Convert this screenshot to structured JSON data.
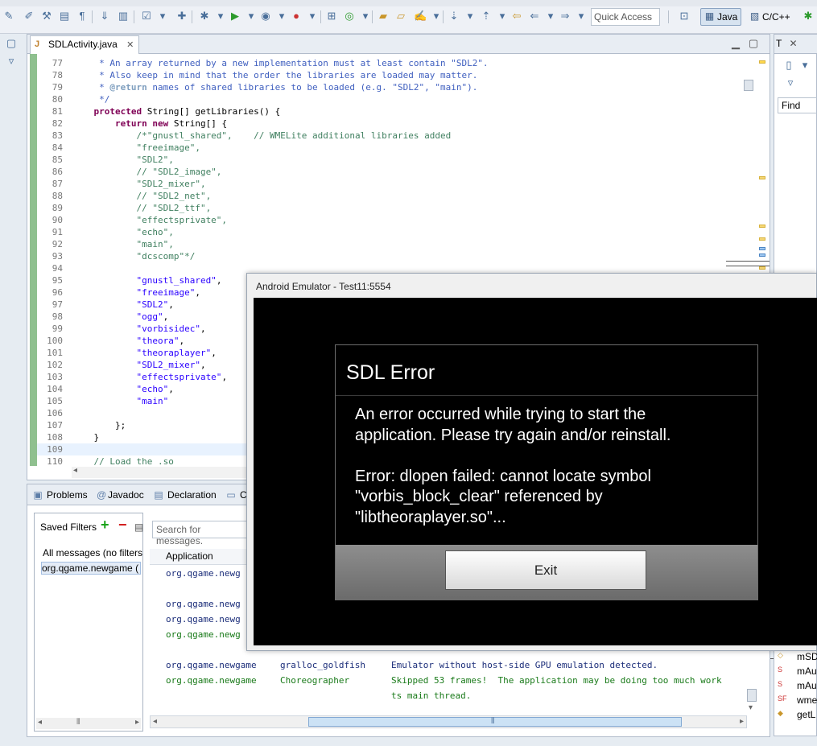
{
  "toolbar": {
    "quick_access_placeholder": "Quick Access",
    "perspectives": [
      {
        "label": "Java",
        "icon": "java-perspective-icon",
        "active": true
      },
      {
        "label": "C/C++",
        "icon": "cpp-perspective-icon",
        "active": false
      }
    ]
  },
  "editor": {
    "tab_title": "SDLActivity.java",
    "lines": [
      {
        "n": "77",
        "parts": [
          {
            "c": "doc",
            "t": "     * An array returned by a new implementation must at least contain \"SDL2\"."
          }
        ]
      },
      {
        "n": "78",
        "parts": [
          {
            "c": "doc",
            "t": "     * Also keep in mind that the order the libraries are loaded may matter."
          }
        ]
      },
      {
        "n": "79",
        "parts": [
          {
            "c": "doc",
            "t": "     * "
          },
          {
            "c": "tag",
            "t": "@return"
          },
          {
            "c": "doc",
            "t": " names of shared libraries to be loaded (e.g. \"SDL2\", \"main\")."
          }
        ]
      },
      {
        "n": "80",
        "parts": [
          {
            "c": "doc",
            "t": "     */"
          }
        ]
      },
      {
        "n": "81",
        "parts": [
          {
            "c": "kw",
            "t": "    protected "
          },
          {
            "c": "",
            "t": "String[] getLibraries() {"
          }
        ]
      },
      {
        "n": "82",
        "parts": [
          {
            "c": "kw",
            "t": "        return new "
          },
          {
            "c": "",
            "t": "String[] {"
          }
        ]
      },
      {
        "n": "83",
        "parts": [
          {
            "c": "cm",
            "t": "            /*\"gnustl_shared\",    // WMELite additional libraries added"
          }
        ]
      },
      {
        "n": "84",
        "parts": [
          {
            "c": "cm",
            "t": "            \"freeimage\","
          }
        ]
      },
      {
        "n": "85",
        "parts": [
          {
            "c": "cm",
            "t": "            \"SDL2\","
          }
        ]
      },
      {
        "n": "86",
        "parts": [
          {
            "c": "cm",
            "t": "            // \"SDL2_image\","
          }
        ]
      },
      {
        "n": "87",
        "parts": [
          {
            "c": "cm",
            "t": "            \"SDL2_mixer\","
          }
        ]
      },
      {
        "n": "88",
        "parts": [
          {
            "c": "cm",
            "t": "            // \"SDL2_net\","
          }
        ]
      },
      {
        "n": "89",
        "parts": [
          {
            "c": "cm",
            "t": "            // \"SDL2_ttf\","
          }
        ]
      },
      {
        "n": "90",
        "parts": [
          {
            "c": "cm",
            "t": "            \"effectsprivate\","
          }
        ]
      },
      {
        "n": "91",
        "parts": [
          {
            "c": "cm",
            "t": "            \"echo\","
          }
        ]
      },
      {
        "n": "92",
        "parts": [
          {
            "c": "cm",
            "t": "            \"main\","
          }
        ]
      },
      {
        "n": "93",
        "parts": [
          {
            "c": "cm",
            "t": "            \"dcscomp\"*/"
          }
        ]
      },
      {
        "n": "94",
        "parts": [
          {
            "c": "",
            "t": ""
          }
        ]
      },
      {
        "n": "95",
        "parts": [
          {
            "c": "st",
            "t": "            \"gnustl_shared\""
          },
          {
            "c": "",
            "t": ","
          }
        ]
      },
      {
        "n": "96",
        "parts": [
          {
            "c": "st",
            "t": "            \"freeimage\""
          },
          {
            "c": "",
            "t": ","
          }
        ]
      },
      {
        "n": "97",
        "parts": [
          {
            "c": "st",
            "t": "            \"SDL2\""
          },
          {
            "c": "",
            "t": ","
          }
        ]
      },
      {
        "n": "98",
        "parts": [
          {
            "c": "st",
            "t": "            \"ogg\""
          },
          {
            "c": "",
            "t": ","
          }
        ]
      },
      {
        "n": "99",
        "parts": [
          {
            "c": "st",
            "t": "            \"vorbisidec\""
          },
          {
            "c": "",
            "t": ","
          }
        ]
      },
      {
        "n": "100",
        "parts": [
          {
            "c": "st",
            "t": "            \"theora\""
          },
          {
            "c": "",
            "t": ","
          }
        ]
      },
      {
        "n": "101",
        "parts": [
          {
            "c": "st",
            "t": "            \"theoraplayer\""
          },
          {
            "c": "",
            "t": ","
          }
        ]
      },
      {
        "n": "102",
        "parts": [
          {
            "c": "st",
            "t": "            \"SDL2_mixer\""
          },
          {
            "c": "",
            "t": ","
          }
        ]
      },
      {
        "n": "103",
        "parts": [
          {
            "c": "st",
            "t": "            \"effectsprivate\""
          },
          {
            "c": "",
            "t": ","
          }
        ]
      },
      {
        "n": "104",
        "parts": [
          {
            "c": "st",
            "t": "            \"echo\""
          },
          {
            "c": "",
            "t": ","
          }
        ]
      },
      {
        "n": "105",
        "parts": [
          {
            "c": "st",
            "t": "            \"main\""
          }
        ]
      },
      {
        "n": "106",
        "parts": [
          {
            "c": "",
            "t": ""
          }
        ]
      },
      {
        "n": "107",
        "parts": [
          {
            "c": "",
            "t": "        };"
          }
        ]
      },
      {
        "n": "108",
        "parts": [
          {
            "c": "",
            "t": "    }"
          }
        ]
      },
      {
        "n": "109",
        "parts": [
          {
            "c": "",
            "t": ""
          }
        ],
        "highlight": true
      },
      {
        "n": "110",
        "parts": [
          {
            "c": "cm",
            "t": "    // Load the .so"
          }
        ]
      }
    ]
  },
  "bottom": {
    "tabs": [
      {
        "label": "Problems",
        "icon": "problems-icon"
      },
      {
        "label": "Javadoc",
        "icon": "at-icon"
      },
      {
        "label": "Declaration",
        "icon": "declaration-icon"
      },
      {
        "label": "C",
        "icon": "console-icon"
      }
    ],
    "saved_filters_label": "Saved Filters",
    "filters": [
      "All messages (no filters)",
      "org.qgame.newgame ("
    ],
    "search_placeholder": "Search for messages.",
    "column_application": "Application",
    "log_rows": [
      {
        "app": "org.qgame.newg",
        "tag": "",
        "msg": "",
        "color": "blue"
      },
      {
        "app": "",
        "tag": "",
        "msg": "",
        "color": "blue"
      },
      {
        "app": "org.qgame.newg",
        "tag": "",
        "msg": "",
        "color": "blue"
      },
      {
        "app": "org.qgame.newg",
        "tag": "",
        "msg": "",
        "color": "blue"
      },
      {
        "app": "org.qgame.newg",
        "tag": "",
        "msg": "",
        "color": "green"
      },
      {
        "app": "",
        "tag": "",
        "msg": "",
        "color": "blue"
      },
      {
        "app": "org.qgame.newgame",
        "tag": "gralloc_goldfish",
        "msg": "Emulator without host-side GPU emulation detected.",
        "color": "blue"
      },
      {
        "app": "org.qgame.newgame",
        "tag": "Choreographer",
        "msg": "Skipped 53 frames!  The application may be doing too much work",
        "color": "green"
      },
      {
        "app": "",
        "tag": "",
        "msg": "ts main thread.",
        "color": "green"
      }
    ]
  },
  "right_pane": {
    "tab_label": "T",
    "find_label": "Find",
    "outline_items": [
      "mSD",
      "mAu",
      "mAu",
      "wme",
      "getL"
    ]
  },
  "emulator": {
    "window_title": "Android Emulator - Test11:5554",
    "dialog_title": "SDL Error",
    "message_lines": [
      "An error occurred while trying to start the",
      "application. Please try again and/or reinstall.",
      "",
      "Error: dlopen failed: cannot locate symbol",
      "\"vorbis_block_clear\" referenced by",
      "\"libtheoraplayer.so\"..."
    ],
    "exit_label": "Exit"
  }
}
